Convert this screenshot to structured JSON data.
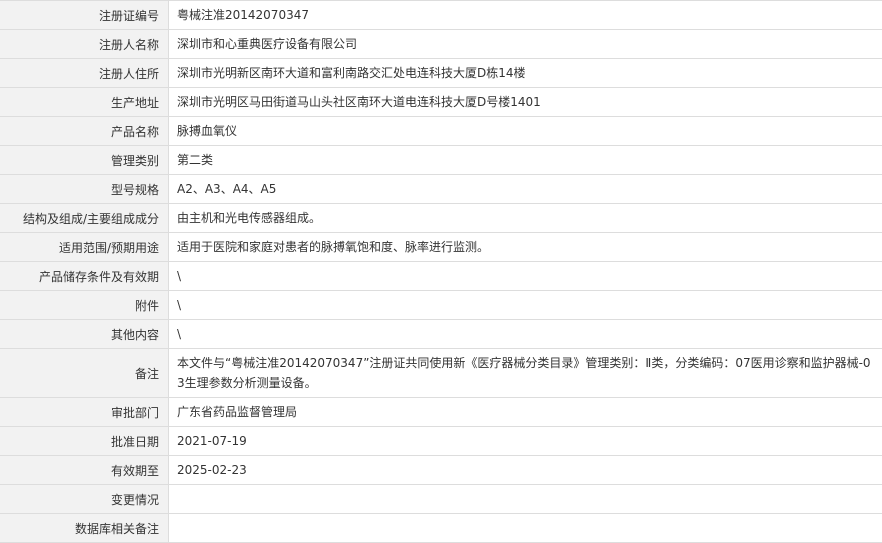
{
  "rows": [
    {
      "label": "注册证编号",
      "value": "粤械注准20142070347"
    },
    {
      "label": "注册人名称",
      "value": "深圳市和心重典医疗设备有限公司"
    },
    {
      "label": "注册人住所",
      "value": "深圳市光明新区南环大道和富利南路交汇处电连科技大厦D栋14楼"
    },
    {
      "label": "生产地址",
      "value": "深圳市光明区马田街道马山头社区南环大道电连科技大厦D号楼1401"
    },
    {
      "label": "产品名称",
      "value": "脉搏血氧仪"
    },
    {
      "label": "管理类别",
      "value": "第二类"
    },
    {
      "label": "型号规格",
      "value": "A2、A3、A4、A5"
    },
    {
      "label": "结构及组成/主要组成成分",
      "value": "由主机和光电传感器组成。"
    },
    {
      "label": "适用范围/预期用途",
      "value": "适用于医院和家庭对患者的脉搏氧饱和度、脉率进行监测。"
    },
    {
      "label": "产品储存条件及有效期",
      "value": "\\"
    },
    {
      "label": "附件",
      "value": "\\"
    },
    {
      "label": "其他内容",
      "value": "\\"
    },
    {
      "label": "备注",
      "value": "本文件与“粤械注准20142070347”注册证共同使用新《医疗器械分类目录》管理类别：Ⅱ类，分类编码：07医用诊察和监护器械-03生理参数分析测量设备。"
    },
    {
      "label": "审批部门",
      "value": "广东省药品监督管理局"
    },
    {
      "label": "批准日期",
      "value": "2021-07-19"
    },
    {
      "label": "有效期至",
      "value": "2025-02-23"
    },
    {
      "label": "变更情况",
      "value": ""
    },
    {
      "label": "数据库相关备注",
      "value": ""
    }
  ]
}
